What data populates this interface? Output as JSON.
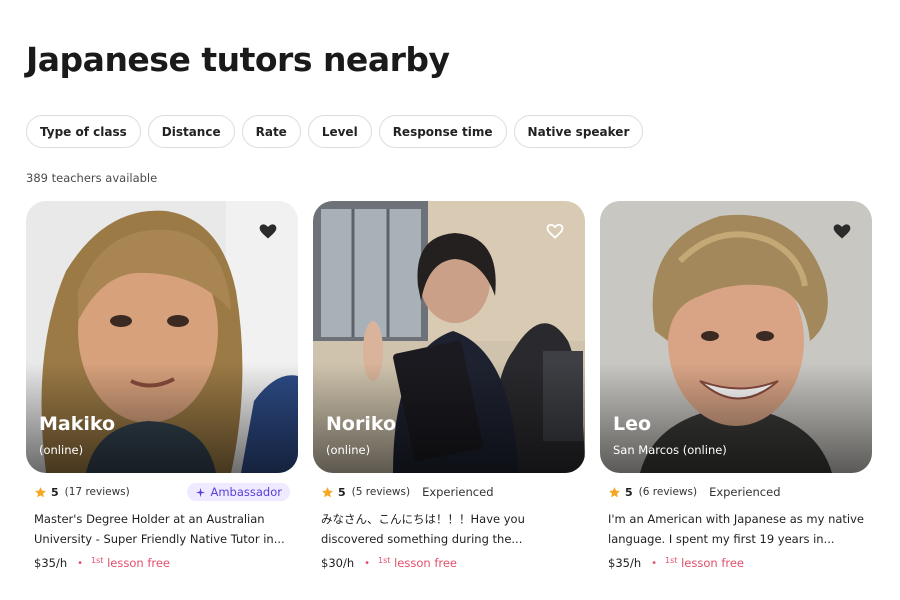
{
  "page": {
    "title": "Japanese tutors nearby",
    "count_text": "389 teachers available"
  },
  "filters": [
    "Type of class",
    "Distance",
    "Rate",
    "Level",
    "Response time",
    "Native speaker"
  ],
  "tutors": [
    {
      "name": "Makiko",
      "location": "(online)",
      "rating": "5",
      "reviews": "(17 reviews)",
      "badge": "Ambassador",
      "description": "Master's Degree Holder at an Australian University - Super Friendly Native Tutor in...",
      "price": "$35/h",
      "lesson_sup": "1st",
      "lesson_text": "lesson free"
    },
    {
      "name": "Noriko",
      "location": "(online)",
      "rating": "5",
      "reviews": "(5 reviews)",
      "badge": "Experienced",
      "description": "みなさん、こんにちは！！！Have you discovered something during the...",
      "price": "$30/h",
      "lesson_sup": "1st",
      "lesson_text": "lesson free"
    },
    {
      "name": "Leo",
      "location": "San Marcos (online)",
      "rating": "5",
      "reviews": "(6 reviews)",
      "badge": "Experienced",
      "description": "I'm an American with Japanese as my native language. I spent my first 19 years in...",
      "price": "$35/h",
      "lesson_sup": "1st",
      "lesson_text": "lesson free"
    }
  ],
  "colors": {
    "accent_pink": "#e0506a",
    "star": "#f5a623",
    "ambassador_bg": "#efeaff",
    "ambassador_text": "#5b3fd6"
  },
  "icons": [
    "heart-icon",
    "star-icon",
    "sparkle-icon"
  ]
}
